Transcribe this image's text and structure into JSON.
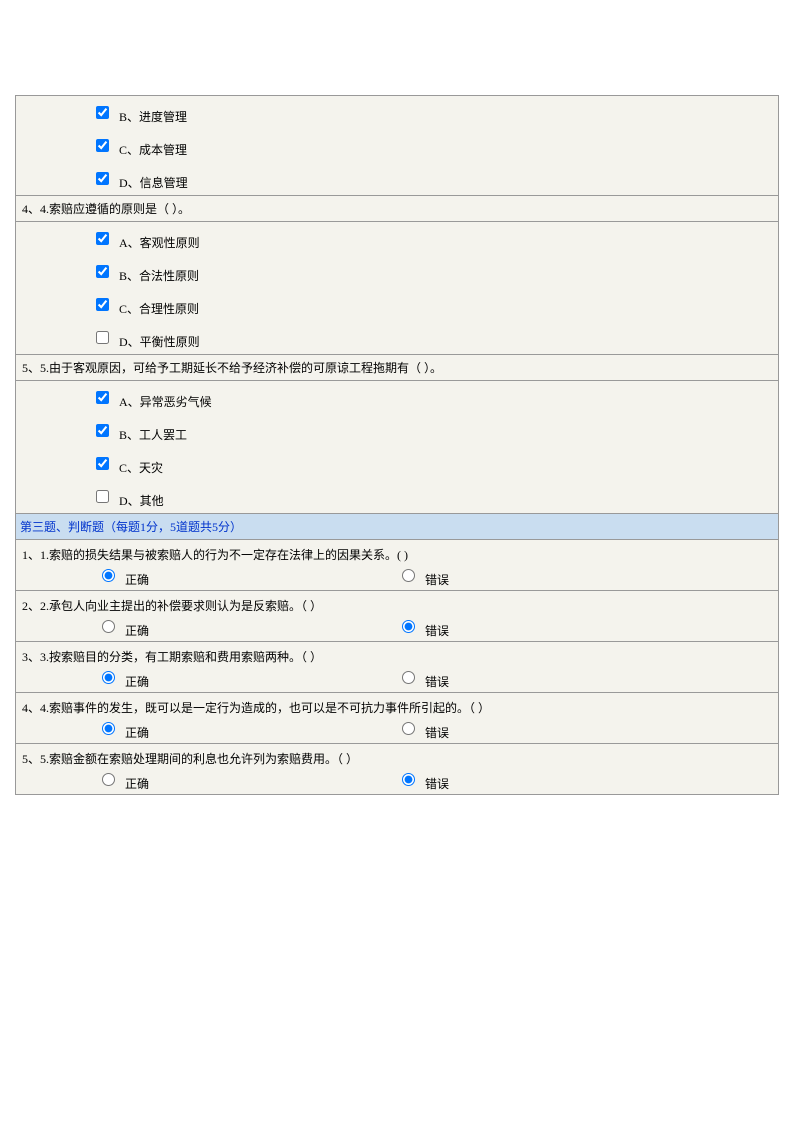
{
  "mc_top": {
    "options": [
      {
        "key": "b",
        "label": "B、进度管理",
        "checked": true
      },
      {
        "key": "c",
        "label": "C、成本管理",
        "checked": true
      },
      {
        "key": "d",
        "label": "D、信息管理",
        "checked": true
      }
    ]
  },
  "mc_q4": {
    "title": "4、4.索赔应遵循的原则是（  ）。",
    "options": [
      {
        "key": "a",
        "label": "A、客观性原则",
        "checked": true
      },
      {
        "key": "b",
        "label": "B、合法性原则",
        "checked": true
      },
      {
        "key": "c",
        "label": "C、合理性原则",
        "checked": true
      },
      {
        "key": "d",
        "label": "D、平衡性原则",
        "checked": false
      }
    ]
  },
  "mc_q5": {
    "title": "5、5.由于客观原因，可给予工期延长不给予经济补偿的可原谅工程拖期有（  ）。",
    "options": [
      {
        "key": "a",
        "label": "A、异常恶劣气候",
        "checked": true
      },
      {
        "key": "b",
        "label": "B、工人罢工",
        "checked": true
      },
      {
        "key": "c",
        "label": "C、天灾",
        "checked": true
      },
      {
        "key": "d",
        "label": "D、其他",
        "checked": false
      }
    ]
  },
  "section3": {
    "header": "第三题、判断题（每题1分，5道题共5分）",
    "true_label": "正确",
    "false_label": "错误",
    "items": [
      {
        "id": "q1",
        "title": "1、1.索赔的损失结果与被索赔人的行为不一定存在法律上的因果关系。( )",
        "answer": "true"
      },
      {
        "id": "q2",
        "title": "2、2.承包人向业主提出的补偿要求则认为是反索赔。（ ）",
        "answer": "false"
      },
      {
        "id": "q3",
        "title": "3、3.按索赔目的分类，有工期索赔和费用索赔两种。（ ）",
        "answer": "true"
      },
      {
        "id": "q4",
        "title": "4、4.索赔事件的发生，既可以是一定行为造成的，也可以是不可抗力事件所引起的。（  ）",
        "answer": "true"
      },
      {
        "id": "q5",
        "title": "5、5.索赔金额在索赔处理期间的利息也允许列为索赔费用。（ ）",
        "answer": "false"
      }
    ]
  }
}
